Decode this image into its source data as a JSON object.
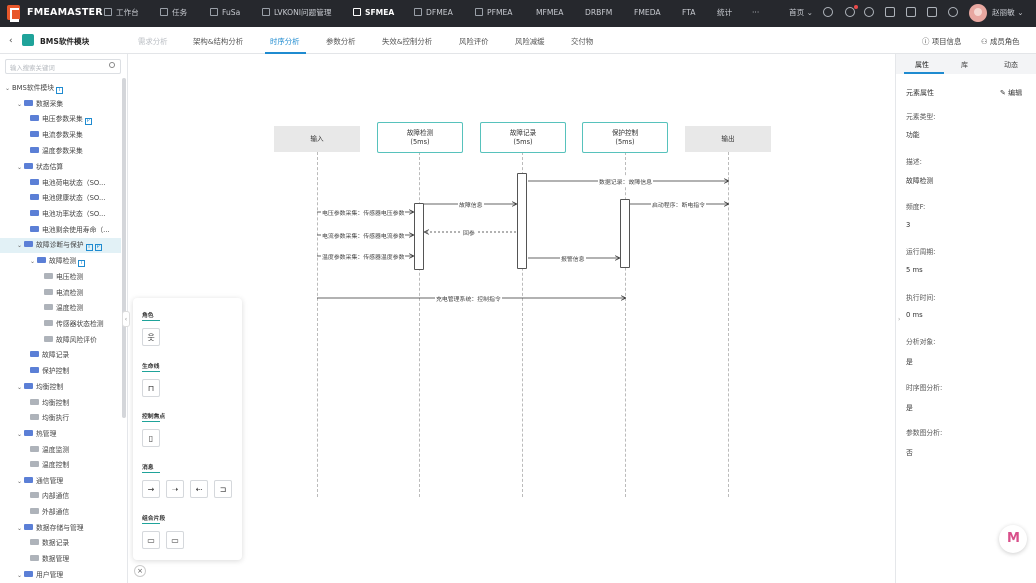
{
  "topbar": {
    "brand": "FMEAMASTER",
    "nav": [
      {
        "label": "工作台"
      },
      {
        "label": "任务"
      },
      {
        "label": "FuSa"
      },
      {
        "label": "LVKONI问题管理"
      },
      {
        "label": "SFMEA"
      },
      {
        "label": "DFMEA"
      },
      {
        "label": "PFMEA"
      },
      {
        "label": "MFMEA"
      },
      {
        "label": "DRBFM"
      },
      {
        "label": "FMEDA"
      },
      {
        "label": "FTA"
      },
      {
        "label": "统计"
      },
      {
        "label": "···"
      }
    ],
    "home_label": "首页",
    "user_name": "赵丽敏"
  },
  "subbar": {
    "back": "‹",
    "module_title": "BMS软件模块",
    "tabs": [
      {
        "label": "需求分析"
      },
      {
        "label": "架构&结构分析"
      },
      {
        "label": "时序分析"
      },
      {
        "label": "参数分析"
      },
      {
        "label": "失效&控制分析"
      },
      {
        "label": "风险评价"
      },
      {
        "label": "风险减缓"
      },
      {
        "label": "交付物"
      }
    ],
    "project_info": "项目信息",
    "members": "成员角色"
  },
  "sidebar": {
    "search_placeholder": "输入搜索关键词",
    "tree": [
      {
        "label": "BMS软件模块",
        "mark": "T"
      },
      {
        "label": "数据采集"
      },
      {
        "label": "电压参数采集",
        "mark": "P"
      },
      {
        "label": "电流参数采集"
      },
      {
        "label": "温度参数采集"
      },
      {
        "label": "状态估算"
      },
      {
        "label": "电池荷电状态（SO..."
      },
      {
        "label": "电池健康状态（SO..."
      },
      {
        "label": "电池功率状态（SO..."
      },
      {
        "label": "电池剩余使用寿命（..."
      },
      {
        "label": "故障诊断与保护",
        "mark": "T",
        "mark2": "P"
      },
      {
        "label": "故障检测",
        "mark": "T"
      },
      {
        "label": "电压检测"
      },
      {
        "label": "电流检测"
      },
      {
        "label": "温度检测"
      },
      {
        "label": "传感器状态检测"
      },
      {
        "label": "故障风险评价"
      },
      {
        "label": "故障记录"
      },
      {
        "label": "保护控制"
      },
      {
        "label": "均衡控制"
      },
      {
        "label": "均衡控制"
      },
      {
        "label": "均衡执行"
      },
      {
        "label": "热管理"
      },
      {
        "label": "温度监测"
      },
      {
        "label": "温度控制"
      },
      {
        "label": "通信管理"
      },
      {
        "label": "内部通信"
      },
      {
        "label": "外部通信"
      },
      {
        "label": "数据存储与管理"
      },
      {
        "label": "数据记录"
      },
      {
        "label": "数据管理"
      },
      {
        "label": "用户管理"
      }
    ]
  },
  "diagram": {
    "lifelines": [
      {
        "label": "输入",
        "sub": ""
      },
      {
        "label": "故障检测",
        "sub": "(5ms)"
      },
      {
        "label": "故障记录",
        "sub": "(5ms)"
      },
      {
        "label": "保护控制",
        "sub": "(5ms)"
      },
      {
        "label": "输出",
        "sub": ""
      }
    ],
    "messages": [
      {
        "label": "数据记录：故障信息"
      },
      {
        "label": "故障信息"
      },
      {
        "label": "启动程序：断电指令"
      },
      {
        "label": "电压参数采集：传感器电压参数"
      },
      {
        "label": "回参"
      },
      {
        "label": "电流参数采集：传感器电流参数"
      },
      {
        "label": "温度参数采集：传感器温度参数"
      },
      {
        "label": "报警信息"
      },
      {
        "label": "充电管理系统：控制指令"
      }
    ]
  },
  "palette": {
    "sections": [
      {
        "title": "角色"
      },
      {
        "title": "生命线"
      },
      {
        "title": "控制焦点"
      },
      {
        "title": "消息"
      },
      {
        "title": "组合片段"
      }
    ],
    "close": "×",
    "collapse": "‹"
  },
  "rpanel": {
    "tabs": [
      {
        "label": "属性"
      },
      {
        "label": "库"
      },
      {
        "label": "动态"
      }
    ],
    "heading": "元素属性",
    "edit": "编辑",
    "fields": [
      {
        "label": "元素类型:",
        "value": "功能"
      },
      {
        "label": "描述:",
        "value": "故障检测"
      },
      {
        "label": "频度F:",
        "value": "3"
      },
      {
        "label": "运行周期:",
        "value": "5  ms"
      },
      {
        "label": "执行时间:",
        "value": "0  ms"
      },
      {
        "label": "分析对象:",
        "value": "是"
      },
      {
        "label": "时序图分析:",
        "value": "是"
      },
      {
        "label": "参数图分析:",
        "value": "否"
      }
    ],
    "edge_arrow": "›"
  },
  "fab": {
    "label": "M"
  },
  "colors": {
    "topbar": "#26282d",
    "accent": "#1f8bd0",
    "teal": "#1fa39a",
    "badge": "#e8572a"
  }
}
